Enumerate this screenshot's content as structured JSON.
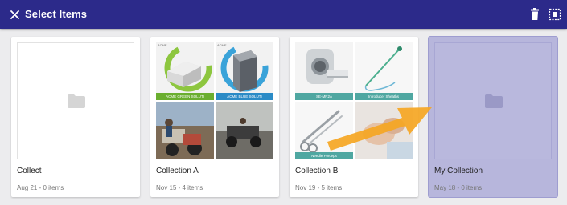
{
  "header": {
    "title": "Select Items",
    "close_icon": "close-icon",
    "delete_icon": "trash-icon",
    "select_all_icon": "select-all-icon"
  },
  "colors": {
    "primary": "#2c2a8a",
    "selected_card": "#b7b6dc",
    "arrow": "#f5a623"
  },
  "collections": [
    {
      "title": "Collect",
      "meta": "Aug 21 - 0 items",
      "selected": false
    },
    {
      "title": "Collection A",
      "meta": "Nov 15 - 4 items",
      "selected": false,
      "tiles": [
        {
          "caption": "ACME GREEN SOLUTI",
          "badge": "ACME"
        },
        {
          "caption": "ACME BLUE SOLUTI",
          "badge": "ACME"
        },
        {
          "caption": ""
        },
        {
          "caption": ""
        }
      ]
    },
    {
      "title": "Collection B",
      "meta": "Nov 19 - 5 items",
      "selected": false,
      "tiles": [
        {
          "caption": "SE-MR2A"
        },
        {
          "caption": "Introducer Sheaths"
        },
        {
          "caption": "Needle Forceps"
        },
        {
          "caption": ""
        }
      ]
    },
    {
      "title": "My Collection",
      "meta": "May 18 - 0 items",
      "selected": true
    }
  ]
}
